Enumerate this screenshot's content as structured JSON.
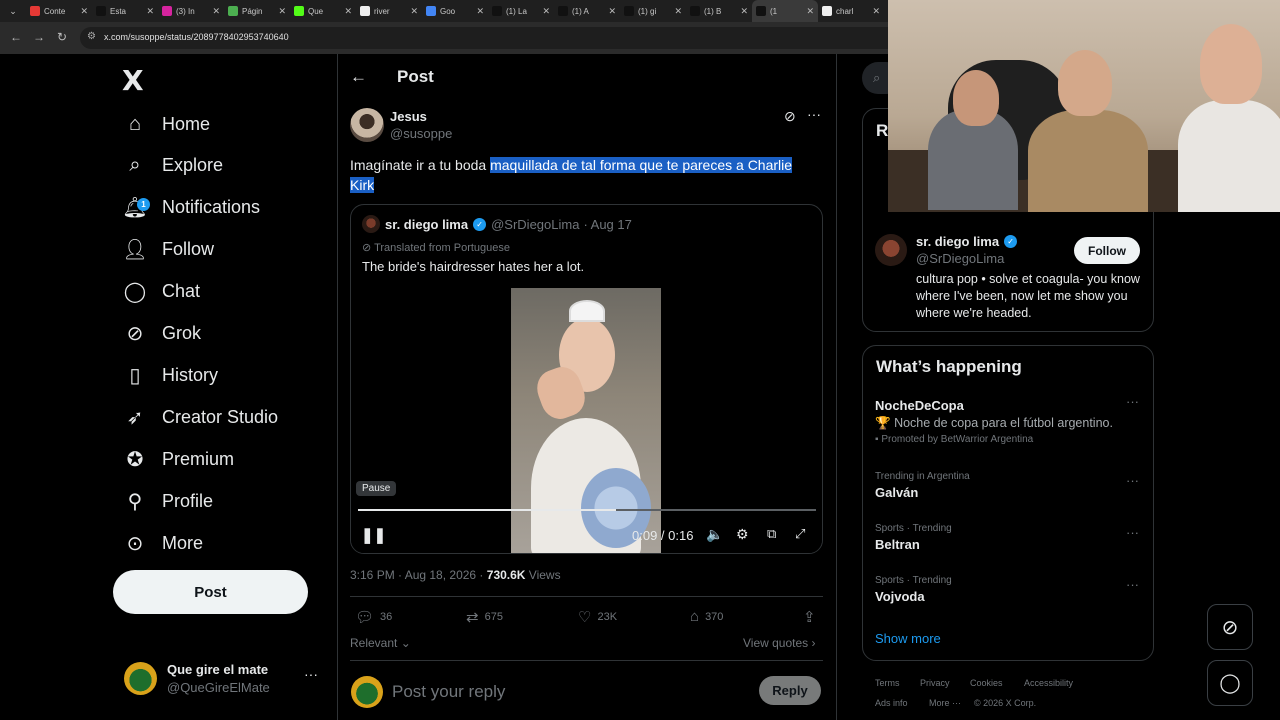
{
  "browser": {
    "tabs": [
      {
        "title": "Conte",
        "color": "#e53935"
      },
      {
        "title": "Esta",
        "color": "#111111"
      },
      {
        "title": "(3) In",
        "color": "#d6249f"
      },
      {
        "title": "Págin",
        "color": "#4caf50"
      },
      {
        "title": "Que",
        "color": "#53fc18"
      },
      {
        "title": "river",
        "color": "#eeeeee"
      },
      {
        "title": "Goo",
        "color": "#4285f4"
      },
      {
        "title": "(1) La",
        "color": "#111111"
      },
      {
        "title": "(1) A",
        "color": "#111111"
      },
      {
        "title": "(1) gi",
        "color": "#111111"
      },
      {
        "title": "(1) B",
        "color": "#111111"
      },
      {
        "title": "(1",
        "color": "#111111"
      },
      {
        "title": "charl",
        "color": "#eeeeee"
      }
    ],
    "url": "x.com/susoppe/status/2089778402953740640"
  },
  "sidebar": {
    "logo": "X",
    "items": [
      {
        "label": "Home",
        "icon": "home-icon"
      },
      {
        "label": "Explore",
        "icon": "search-icon"
      },
      {
        "label": "Notifications",
        "icon": "bell-icon",
        "badge": "1"
      },
      {
        "label": "Follow",
        "icon": "follow-icon"
      },
      {
        "label": "Chat",
        "icon": "chat-icon"
      },
      {
        "label": "Grok",
        "icon": "grok-icon"
      },
      {
        "label": "History",
        "icon": "bookmark-icon"
      },
      {
        "label": "Creator Studio",
        "icon": "rocket-icon"
      },
      {
        "label": "Premium",
        "icon": "verified-icon"
      },
      {
        "label": "Profile",
        "icon": "person-icon"
      },
      {
        "label": "More",
        "icon": "more-circle-icon"
      }
    ],
    "post_label": "Post",
    "account": {
      "name": "Que gire el mate",
      "handle": "@QueGireElMate"
    }
  },
  "post": {
    "header_title": "Post",
    "author": {
      "name": "Jesus",
      "handle": "@susoppe"
    },
    "text_plain": "Imagínate ir a tu boda ",
    "text_highlight_1": "maquillada de tal forma que te pareces a Charlie ",
    "text_highlight_2": "Kirk",
    "quote": {
      "name": "sr. diego lima",
      "handle": "@SrDiegoLima",
      "date": "· Aug 17",
      "translated": "Translated from Portuguese",
      "text": "The bride's hairdresser hates her a lot."
    },
    "video": {
      "tooltip": "Pause",
      "time": "0:09 / 0:16",
      "progress": 0.5625
    },
    "timestamp": "3:16 PM · Aug 18, 2026 · ",
    "views_count": "730.6K",
    "views_label": " Views",
    "actions": {
      "replies": "36",
      "reposts": "675",
      "likes": "23K",
      "bookmarks": "370"
    },
    "sort_label": "Relevant",
    "view_quotes": "View quotes",
    "reply_placeholder": "Post your reply",
    "reply_button": "Reply"
  },
  "right": {
    "relevant_header_fragment": "R",
    "profile": {
      "name": "sr. diego lima",
      "handle": "@SrDiegoLima",
      "bio": "cultura pop • solve et coagula- you know where I've been, now let me show you where we're headed.",
      "follow_label": "Follow"
    },
    "happening": {
      "title": "What’s happening",
      "promo": {
        "name": "NocheDeCopa",
        "text": "Noche de copa para el fútbol argentino.",
        "promoted": "Promoted by BetWarrior Argentina"
      },
      "trends": [
        {
          "meta": "Trending in Argentina",
          "name": "Galván"
        },
        {
          "meta": "Sports · Trending",
          "name": "Beltran"
        },
        {
          "meta": "Sports · Trending",
          "name": "Vojvoda"
        }
      ],
      "show_more": "Show more"
    },
    "footer": [
      "Terms",
      "Privacy",
      "Cookies",
      "Accessibility",
      "Ads info",
      "More ···",
      "© 2026 X Corp."
    ]
  }
}
